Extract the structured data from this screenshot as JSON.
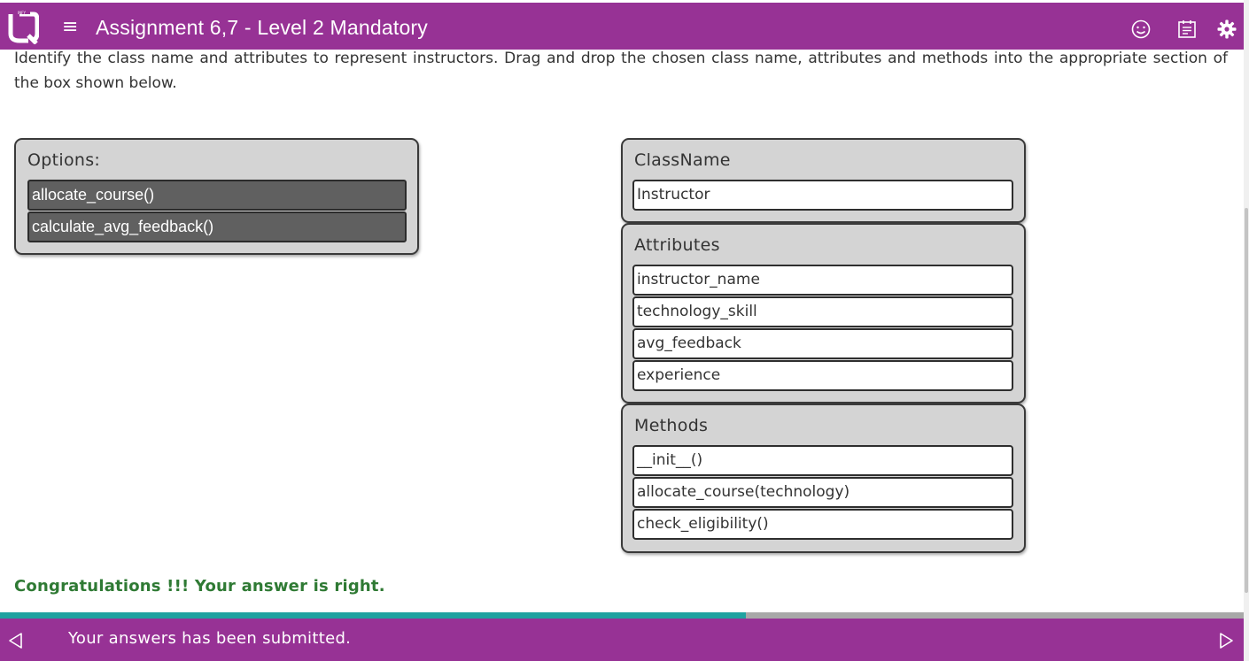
{
  "header": {
    "title": "Assignment 6,7 - Level 2 Mandatory",
    "logo_icon": "infytq-logo",
    "menu_icon": "hamburger-menu-icon",
    "icons": [
      "smiley-icon",
      "calendar-icon",
      "settings-gear-icon"
    ],
    "bg_color": "#973295"
  },
  "question": {
    "text": "Identify the class name and attributes to represent instructors. Drag and drop the chosen class name, attributes and methods into the appropriate section of the box shown below."
  },
  "options": {
    "title": "Options:",
    "items": [
      "allocate_course()",
      "calculate_avg_feedback()"
    ]
  },
  "class_box": {
    "classname": {
      "title": "ClassName",
      "items": [
        "Instructor"
      ]
    },
    "attributes": {
      "title": "Attributes",
      "items": [
        "instructor_name",
        "technology_skill",
        "avg_feedback",
        "experience"
      ]
    },
    "methods": {
      "title": "Methods",
      "items": [
        "__init__()",
        "allocate_course(technology)",
        "check_eligibility()"
      ]
    }
  },
  "result": {
    "message": "Congratulations !!! Your answer is right.",
    "color": "#2f7a34"
  },
  "progress": {
    "fraction": 0.6,
    "color": "#1fa2a0"
  },
  "footer": {
    "status": "Your answers has been submitted.",
    "prev_icon": "triangle-left-icon",
    "next_icon": "triangle-right-icon"
  }
}
